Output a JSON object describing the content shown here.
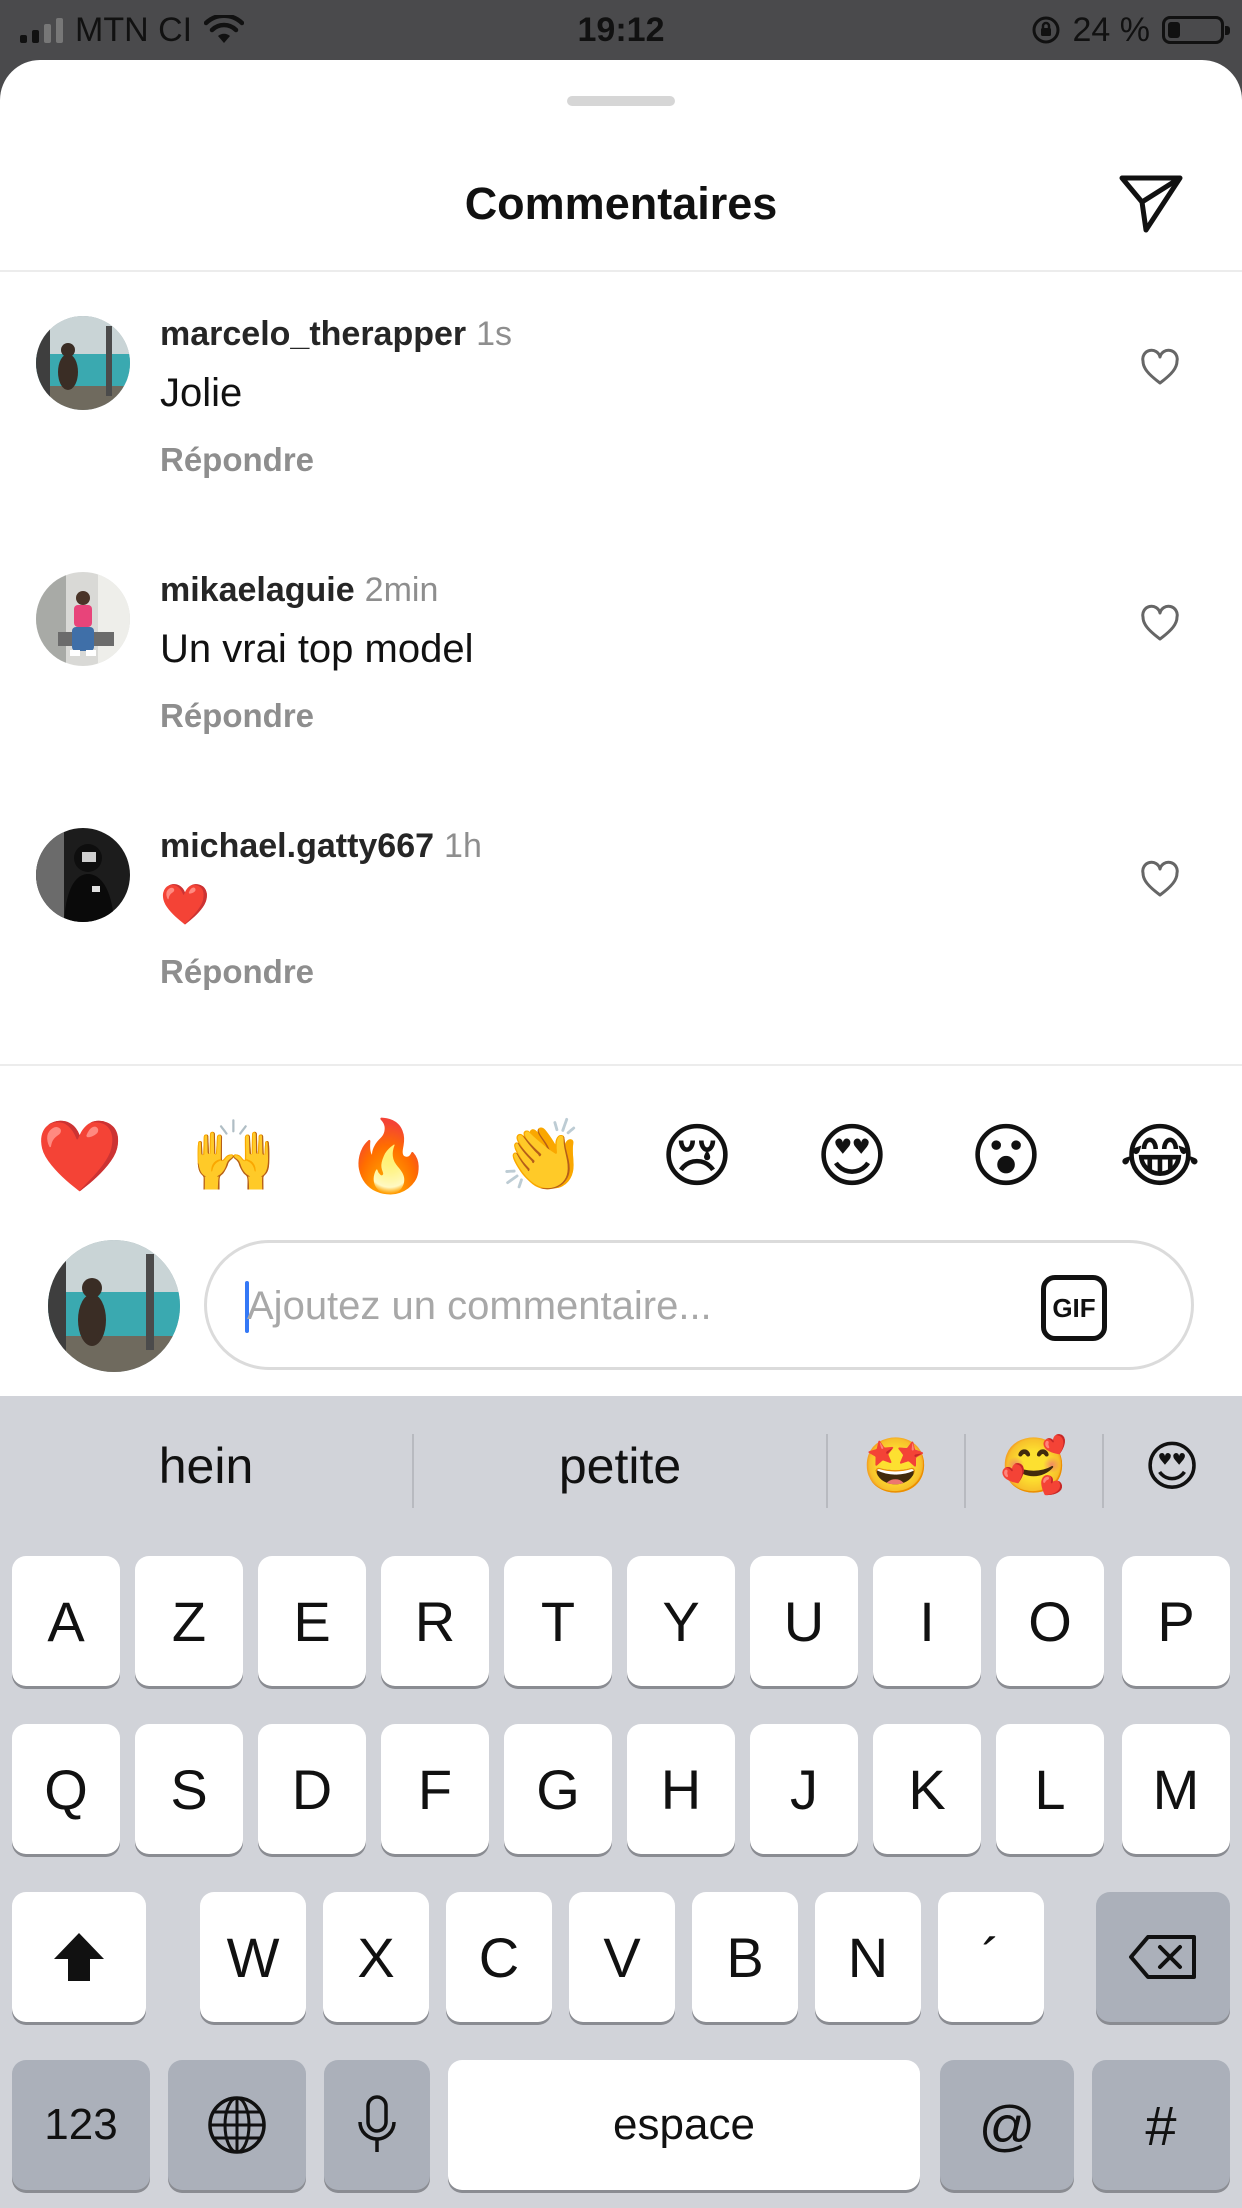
{
  "status_bar": {
    "carrier": "MTN CI",
    "time": "19:12",
    "battery_percent": "24 %",
    "battery_level": 0.24,
    "icons": [
      "signal-icon",
      "wifi-icon",
      "orientation-lock-icon",
      "battery-icon"
    ]
  },
  "sheet": {
    "title": "Commentaires",
    "send_icon": "send-icon"
  },
  "comments": [
    {
      "username": "marcelo_therapper",
      "time": "1s",
      "text": "Jolie",
      "reply": "Répondre",
      "like_icon": "heart-outline-icon"
    },
    {
      "username": "mikaelaguie",
      "time": "2min",
      "text": "Un vrai top model",
      "reply": "Répondre",
      "like_icon": "heart-outline-icon"
    },
    {
      "username": "michael.gatty667",
      "time": "1h",
      "text": "❤️",
      "reply": "Répondre",
      "like_icon": "heart-outline-icon"
    }
  ],
  "emoji_bar": [
    "❤️",
    "🙌",
    "🔥",
    "👏",
    "😢",
    "😍",
    "😮",
    "😂"
  ],
  "composer": {
    "placeholder": "Ajoutez un commentaire...",
    "value": "",
    "gif_label": "GIF"
  },
  "keyboard": {
    "suggestions": [
      "hein",
      "petite",
      "🤩",
      "🥰",
      "😍"
    ],
    "rows": [
      [
        "A",
        "Z",
        "E",
        "R",
        "T",
        "Y",
        "U",
        "I",
        "O",
        "P"
      ],
      [
        "Q",
        "S",
        "D",
        "F",
        "G",
        "H",
        "J",
        "K",
        "L",
        "M"
      ],
      [
        "W",
        "X",
        "C",
        "V",
        "B",
        "N",
        "´"
      ]
    ],
    "numbers_label": "123",
    "space_label": "espace",
    "at_label": "@",
    "hash_label": "#",
    "shift_icon": "shift-icon",
    "delete_icon": "backspace-icon",
    "globe_icon": "globe-icon",
    "mic_icon": "microphone-icon"
  },
  "colors": {
    "accent_caret": "#3478f6",
    "secondary_text": "#8e8e8e",
    "keyboard_bg": "#d1d3d9"
  }
}
